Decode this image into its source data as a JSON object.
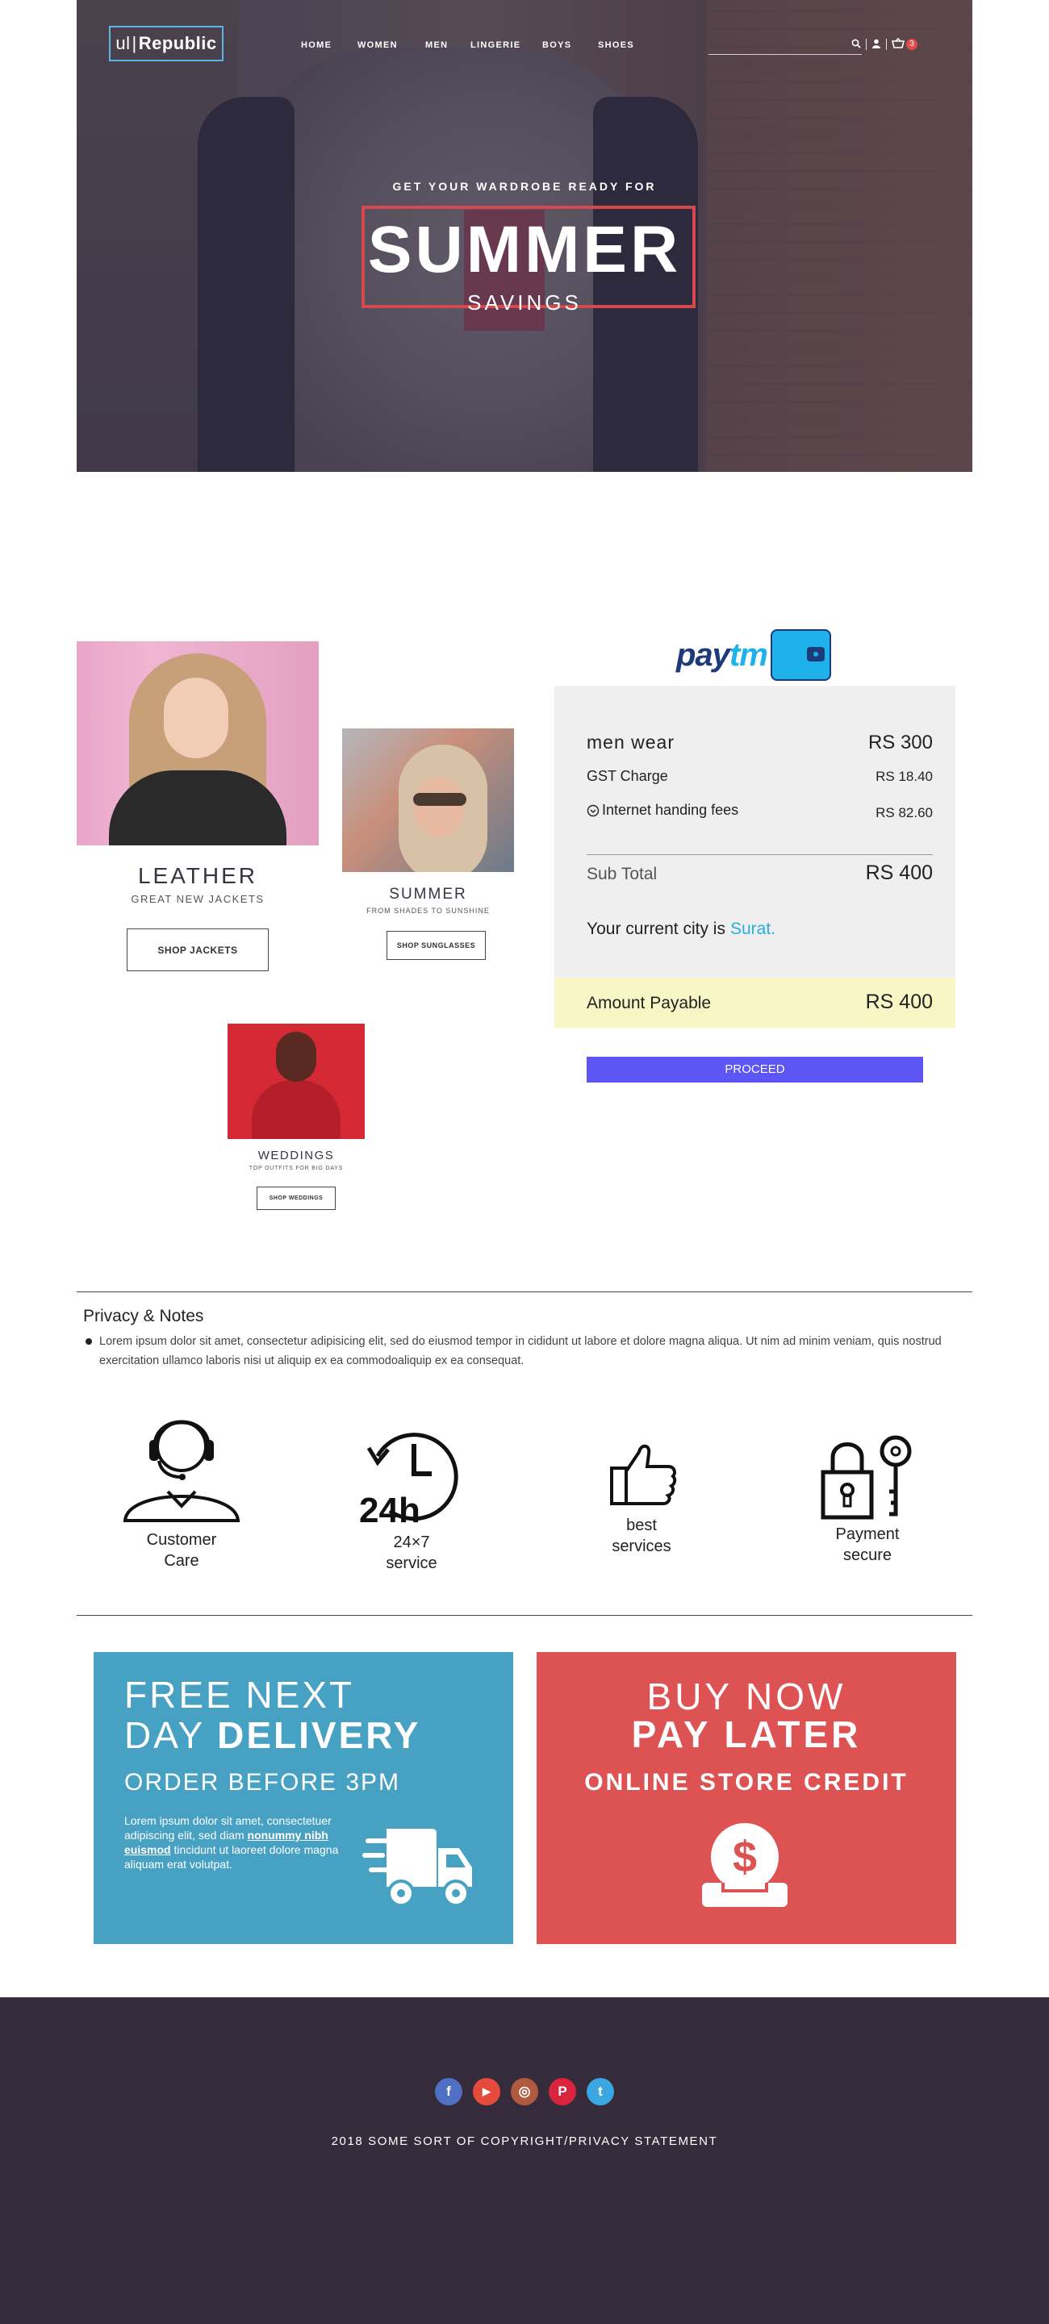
{
  "header": {
    "logo": {
      "prefix": "ul",
      "separator": "|",
      "name": "Republic"
    },
    "nav": [
      "HOME",
      "WOMEN",
      "MEN",
      "LINGERIE",
      "BOYS",
      "SHOES"
    ],
    "search_placeholder": "",
    "icons": [
      "search-icon",
      "user-icon",
      "cart-icon"
    ],
    "cart_count": "3"
  },
  "hero": {
    "kicker": "GET YOUR WARDROBE READY FOR",
    "title": "SUMMER",
    "subtitle": "SAVINGS"
  },
  "products": [
    {
      "title": "LEATHER",
      "subtitle": "GREAT NEW JACKETS",
      "button": "SHOP JACKETS"
    },
    {
      "title": "SUMMER",
      "subtitle": "FROM SHADES TO SUNSHINE",
      "button": "SHOP SUNGLASSES"
    },
    {
      "title": "WEDDINGS",
      "subtitle": "TOP OUTFITS FOR BIG DAYS",
      "button": "SHOP WEDDINGS"
    }
  ],
  "payment": {
    "brand": {
      "pay": "pay",
      "tm": "tm"
    },
    "items": [
      {
        "label": "men wear",
        "value": "RS 300"
      },
      {
        "label": "GST Charge",
        "value": "RS 18.40"
      },
      {
        "label": "Internet handing fees",
        "value": "RS 82.60"
      }
    ],
    "subtotal_label": "Sub Total",
    "subtotal_value": "RS 400",
    "city_prefix": "Your current city is ",
    "city": "Surat.",
    "payable_label": "Amount Payable",
    "payable_value": "RS 400",
    "proceed": "PROCEED"
  },
  "privacy": {
    "title": "Privacy & Notes",
    "text": "Lorem ipsum dolor sit amet, consectetur adipisicing elit, sed do eiusmod tempor in cididunt ut labore et dolore magna aliqua. Ut nim ad minim veniam, quis nostrud exercitation ullamco laboris nisi ut aliquip ex ea commodoaliquip ex ea  consequat."
  },
  "features": [
    {
      "line1": "Customer",
      "line2": "Care",
      "icon": "headset-icon"
    },
    {
      "line1": "24×7",
      "line2": "service",
      "icon": "24h-icon",
      "icon_text": "24h"
    },
    {
      "line1": "best",
      "line2": "services",
      "icon": "thumbs-up-icon"
    },
    {
      "line1": "Payment",
      "line2": "secure",
      "icon": "lock-key-icon"
    }
  ],
  "promos": {
    "delivery": {
      "line1": "FREE NEXT",
      "line2_a": "DAY ",
      "line2_b": "DELIVERY",
      "line3": "ORDER BEFORE 3PM",
      "text_a": "Lorem ipsum dolor sit amet, consectetuer adipiscing elit, sed diam ",
      "link": "nonummy nibh euismod",
      "text_b": " tincidunt ut laoreet dolore magna aliquam erat volutpat.",
      "icon": "truck-icon",
      "color": "#46a1c3"
    },
    "credit": {
      "line1": "BUY NOW",
      "line2": "PAY LATER",
      "line3": "ONLINE STORE CREDIT",
      "icon": "coin-dollar-icon",
      "icon_text": "$",
      "color": "#dd5353"
    }
  },
  "footer": {
    "social": [
      {
        "icon": "facebook-icon",
        "glyph": "f",
        "color": "#4f6fc4"
      },
      {
        "icon": "youtube-icon",
        "glyph": "▶",
        "color": "#e54b3c"
      },
      {
        "icon": "instagram-icon",
        "glyph": "◎",
        "color": "#b05b3f"
      },
      {
        "icon": "pinterest-icon",
        "glyph": "P",
        "color": "#d8253d"
      },
      {
        "icon": "twitter-icon",
        "glyph": "t",
        "color": "#3ba7e0"
      }
    ],
    "copyright": "2018 SOME SORT OF COPYRIGHT/PRIVACY STATEMENT",
    "background": "#362b3b"
  }
}
